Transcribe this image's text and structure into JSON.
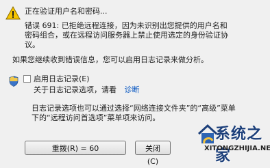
{
  "header": {
    "status": "正在验证用户名和密码...",
    "error_line1": "错误 691: 已拒绝远程连接，因为未识别出您提供的用户名和",
    "error_line2": "密码组合，或在远程访问服务器上禁止使用选定的身份验证协",
    "error_line3": "议。"
  },
  "retry_hint": "如果您继续收到错误信息，您可以启用日志记录来做分析。",
  "logging": {
    "checkbox_label": "启用日志记录(E)",
    "checked": false,
    "about_prefix": "关于日志记录选项，请看",
    "about_link": "诊断"
  },
  "note": {
    "line1": "日志记录选项也可以通过选择“网络连接文件夹”的“高级”菜单",
    "line2": "下的“远程访问首选项”菜单项来访问。"
  },
  "buttons": {
    "redial": "重拨(R) = 60",
    "close": "关闭(C)"
  },
  "watermark": {
    "title": "系统之家",
    "url": "XITONGZHIJIA.NET"
  },
  "colors": {
    "background": "#f0f0f0",
    "link": "#0a58c2",
    "warning": "#f2c200"
  },
  "icons": {
    "warning": "warning-icon",
    "shield": "shield-icon"
  }
}
